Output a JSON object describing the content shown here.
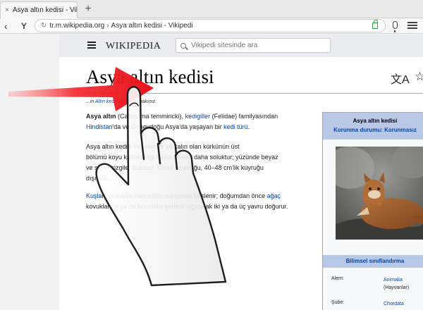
{
  "browser": {
    "tab_title": "Asya altın kedisi - Vikip",
    "tab_close": "×",
    "new_tab": "+",
    "back": "‹",
    "nav_glyph": "Y",
    "url_domain": "tr.m.wikipedia.org",
    "url_sep": "›",
    "url_title": "Asya altın kedisi - Vikipedi"
  },
  "wiki": {
    "logo": "WIKIPEDIA",
    "search_placeholder": "Vikipedi sitesinde ara",
    "title": "Asya altın kedisi",
    "lang_icon": "文A",
    "star_icon": "☆",
    "hatnote_pre": "...in ",
    "hatnote_link": "Altın kedi",
    "hatnote_post": " sayfasına bakınız.",
    "p1": {
      "bold": "Asya altın",
      "t1": " (Catopuma temmincki), ",
      "link1": "kedigiller",
      "t2": " (Felidae) familyasından",
      "link2": "Hindistan",
      "t3": "'da ve Güneydoğu Asya'da yaşayan bir ",
      "link3": "kedi türü",
      "t4": "."
    },
    "p2": {
      "l1": "Asya altın kedisi Hiç lekesiz ve kalın olan kürkünün üst",
      "l2": "bölümü koyu kahverengi tonlarındadır daha soluktur; yüzünde beyaz",
      "l3": "ve siyah çizgiler bulunur. Vücut uzunluğu, 40–48 cm'lik kuyruğu",
      "l4": "dışında..."
    },
    "p3": {
      "link1": "Kuşları",
      "t1": " ve küçük memelileri avlayarak beslenir; doğumdan önce ",
      "link2": "ağaç",
      "t2": "kovuklarına ya da korunaklı yerlere sığınarak iki ya da üç yavru doğurur."
    },
    "infobox": {
      "title": "Asya altın kedisi",
      "status": "Korunma durumu: Korunmasız",
      "classification": "Bilimsel sınıflandırma",
      "rows": [
        {
          "key": "Alem:",
          "value": "Animalia",
          "note": "(Hayvanlar)"
        },
        {
          "key": "Şube:",
          "value": "Chordata",
          "note": ""
        }
      ]
    }
  },
  "colors": {
    "arrow": "#e8141b",
    "link": "#0645ad",
    "infobox_header": "#b9c8e6"
  }
}
